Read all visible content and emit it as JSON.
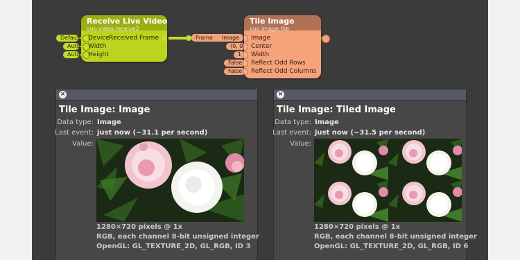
{
  "colors": {
    "canvas": "#3b3b3b",
    "receive_node": "#bcd41f",
    "tile_node": "#f4a37a",
    "cable": "#c4dc2a",
    "popover": "#474747"
  },
  "receive_node": {
    "title": "Receive Live Video",
    "subtitle": "vuo.video.receive2",
    "inputs": [
      "Device",
      "Width",
      "Height"
    ],
    "input_values": [
      "Default",
      "Auto",
      "Auto"
    ],
    "output": "Received Frame"
  },
  "cable": {
    "output_label": "Frame",
    "input_label": "Image"
  },
  "tile_node": {
    "title": "Tile Image",
    "subtitle": "vuo.image.tile",
    "inputs": [
      "Image",
      "Center",
      "Width",
      "Reflect Odd Rows",
      "Reflect Odd Columns"
    ],
    "input_values": [
      "(0, 0)",
      "1",
      "False",
      "False"
    ]
  },
  "popovers": [
    {
      "close_icon": "close-icon",
      "title": "Tile Image: Image",
      "data_type_label": "Data type:",
      "data_type": "Image",
      "last_event_label": "Last event:",
      "last_event": "just now (~31.1 per second)",
      "value_label": "Value:",
      "image_content": "pink-and-white-carnations",
      "info": [
        "1280×720 pixels @ 1x",
        "RGB, each channel 8-bit unsigned integer",
        "OpenGL: GL_TEXTURE_2D, GL_RGB, ID 3"
      ]
    },
    {
      "close_icon": "close-icon",
      "title": "Tile Image: Tiled Image",
      "data_type_label": "Data type:",
      "data_type": "Image",
      "last_event_label": "Last event:",
      "last_event": "just now (~31.5 per second)",
      "value_label": "Value:",
      "image_content": "tiled-carnations-2x2",
      "info": [
        "1280×720 pixels @ 1x",
        "RGB, each channel 8-bit unsigned integer",
        "OpenGL: GL_TEXTURE_2D, GL_RGB, ID 6"
      ]
    }
  ]
}
